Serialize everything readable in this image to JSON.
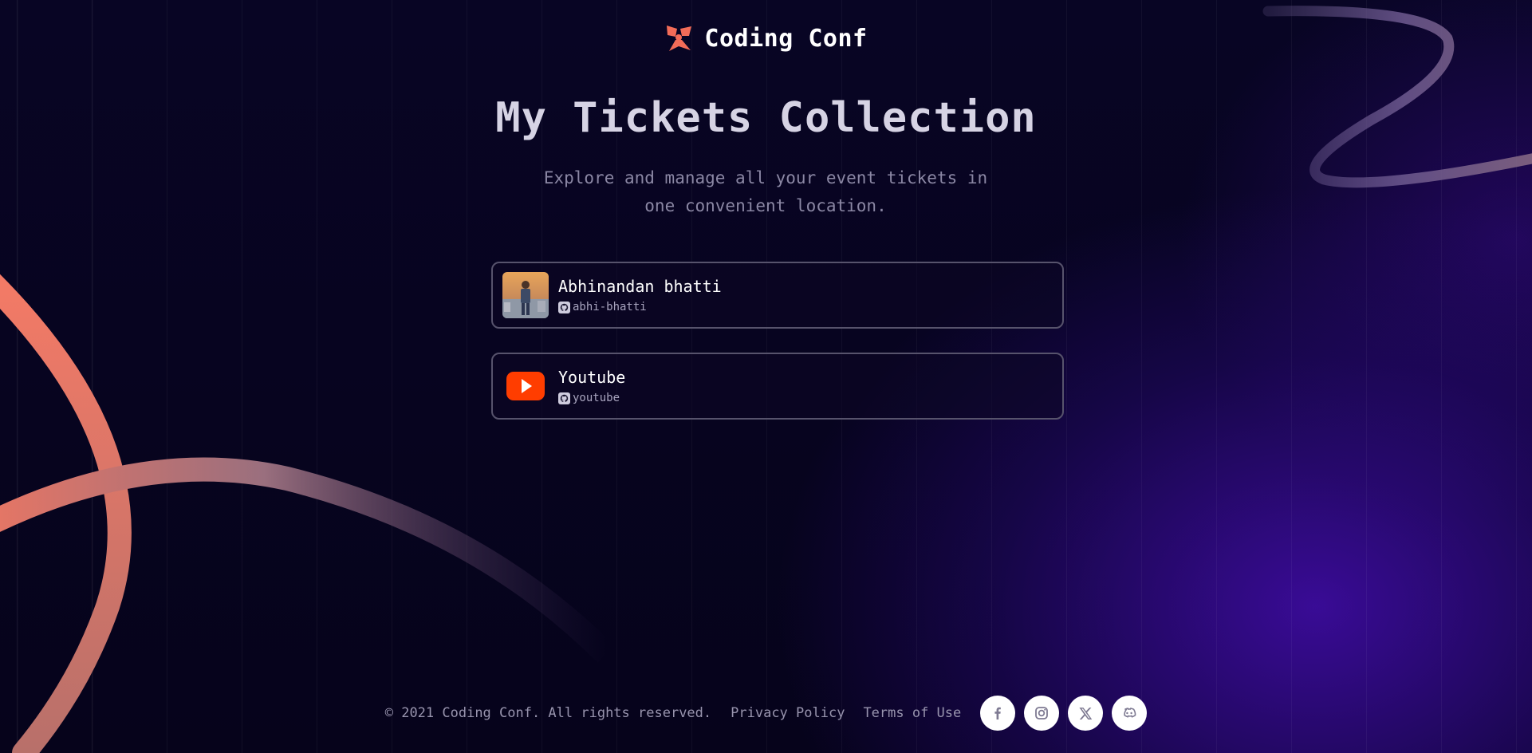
{
  "brand": {
    "name": "Coding Conf",
    "logo_icon": "coding-conf-logo-icon",
    "accent": "#f36c58"
  },
  "main": {
    "title": "My Tickets Collection",
    "subtitle": "Explore and manage all your event tickets in one convenient location."
  },
  "tickets": [
    {
      "name": "Abhinandan bhatti",
      "handle": "abhi-bhatti",
      "thumb_icon": "user-photo-avatar",
      "handle_icon": "github-icon"
    },
    {
      "name": "Youtube",
      "handle": "youtube",
      "thumb_icon": "youtube-icon",
      "handle_icon": "github-icon"
    }
  ],
  "footer": {
    "copyright": "© 2021 Coding Conf. All rights reserved.",
    "links": [
      "Privacy Policy",
      "Terms of Use"
    ],
    "socials": [
      "facebook-icon",
      "instagram-icon",
      "x-icon",
      "discord-icon"
    ]
  },
  "colors": {
    "background": "#07041c",
    "glow": "#4a0ebe",
    "card_border": "#57536c",
    "youtube_red": "#ff3d00"
  }
}
